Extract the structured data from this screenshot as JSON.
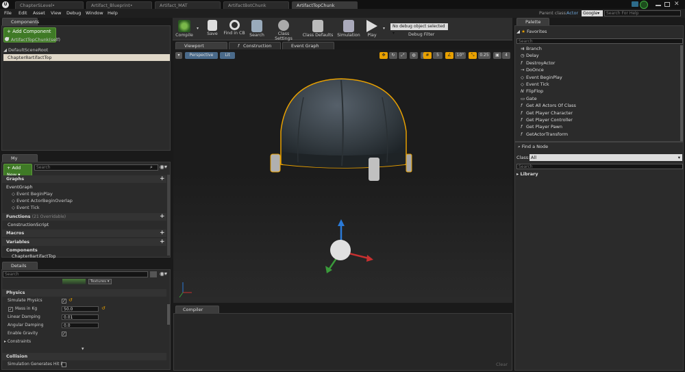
{
  "tabs": [
    "ChapterSLevel•",
    "Artifact_Blueprint•",
    "Artifact_MAT",
    "ArtifactBotChunk",
    "ArtifactTopChunk"
  ],
  "menu": [
    "File",
    "Edit",
    "Asset",
    "View",
    "Debug",
    "Window",
    "Help"
  ],
  "parent_class_label": "Parent class:",
  "parent_class_value": "Actor",
  "search_engine": "Google▾",
  "search_help_placeholder": "Search For Help",
  "components": {
    "title": "Components",
    "add_label": "+ Add Component ▾",
    "self": "ArtifactTopChunk(self)",
    "root": "DefaultSceneRoot",
    "child": "Chapter8artifactTop"
  },
  "toolbar": [
    "Compile",
    "Save",
    "Find in CB",
    "Search",
    "Class Settings",
    "Class Defaults",
    "Simulation",
    "Play"
  ],
  "debug": {
    "select": "No debug object selected ▾",
    "label": "Debug Filter"
  },
  "editor_tabs": [
    "Viewport",
    "Construction Script",
    "Event Graph"
  ],
  "viewport": {
    "perspective": "Perspective",
    "lit": "Lit",
    "snap1": "5",
    "snap2": "10°",
    "snap3": "0.25",
    "snap4": "4"
  },
  "blueprint": {
    "title": "My Blueprint",
    "add_new": "+ Add New ▾",
    "search_placeholder": "Search",
    "graphs": "Graphs",
    "eventgraph": "EventGraph",
    "events": [
      "Event BeginPlay",
      "Event ActorBeginOverlap",
      "Event Tick"
    ],
    "functions": "Functions",
    "overridable": "(21 Overridable)",
    "construction": "ConstructionScript",
    "macros": "Macros",
    "variables": "Variables",
    "components_label": "Components",
    "comp_item": "Chapter8artifactTop"
  },
  "details": {
    "title": "Details",
    "search_placeholder": "Search",
    "textures": "Textures ▾",
    "physics": "Physics",
    "simulate": "Simulate Physics",
    "mass": "Mass in Kg",
    "mass_value": "50.0",
    "linear": "Linear Damping",
    "linear_value": "0.01",
    "angular": "Angular Damping",
    "angular_value": "0.0",
    "gravity": "Enable Gravity",
    "constraints": "Constraints",
    "collision": "Collision",
    "sim_hit": "Simulation Generates Hit Ev"
  },
  "compiler": {
    "title": "Compiler Results",
    "clear": "Clear"
  },
  "palette": {
    "title": "Palette",
    "favorites": "Favorites",
    "search_placeholder": "Search",
    "items": [
      "Branch",
      "Delay",
      "DestroyActor",
      "DoOnce",
      "Event BeginPlay",
      "Event Tick",
      "FlipFlop",
      "Gate",
      "Get All Actors Of Class",
      "Get Player Character",
      "Get Player Controller",
      "Get Player Pawn",
      "GetActorTransform"
    ],
    "find_node": "Find a Node",
    "class_label": "Class:",
    "class_value": "All",
    "search2_placeholder": "Search",
    "library": "Library"
  },
  "colors": {
    "accent": "#e8a000",
    "selection": "#3f7a26",
    "highlight": "#e0d8c8"
  }
}
